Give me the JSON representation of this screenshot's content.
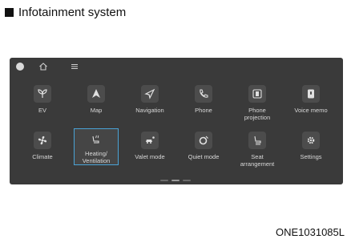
{
  "heading": "Infotainment system",
  "topbar": {
    "profile_icon": "profile-icon",
    "home_icon": "home-icon",
    "menu_icon": "menu-icon"
  },
  "apps_row1": [
    {
      "label": "EV",
      "icon": "ev-leaf-icon"
    },
    {
      "label": "Map",
      "icon": "map-arrow-icon"
    },
    {
      "label": "Navigation",
      "icon": "navigation-icon"
    },
    {
      "label": "Phone",
      "icon": "phone-icon"
    },
    {
      "label": "Phone\nprojection",
      "icon": "phone-projection-icon"
    },
    {
      "label": "Voice memo",
      "icon": "voice-memo-icon"
    }
  ],
  "apps_row2": [
    {
      "label": "Climate",
      "icon": "fan-icon"
    },
    {
      "label": "Heating/\nVentilation",
      "icon": "seat-heating-icon",
      "selected": true
    },
    {
      "label": "Valet mode",
      "icon": "valet-car-icon"
    },
    {
      "label": "Quiet mode",
      "icon": "quiet-mode-icon"
    },
    {
      "label": "Seat\narrangement",
      "icon": "seat-icon"
    },
    {
      "label": "Settings",
      "icon": "gear-icon"
    }
  ],
  "image_code": "ONE1031085L",
  "colors": {
    "screen_bg": "#3a3a3a",
    "selection": "#4aa3d6",
    "label": "#d8d8d8"
  }
}
